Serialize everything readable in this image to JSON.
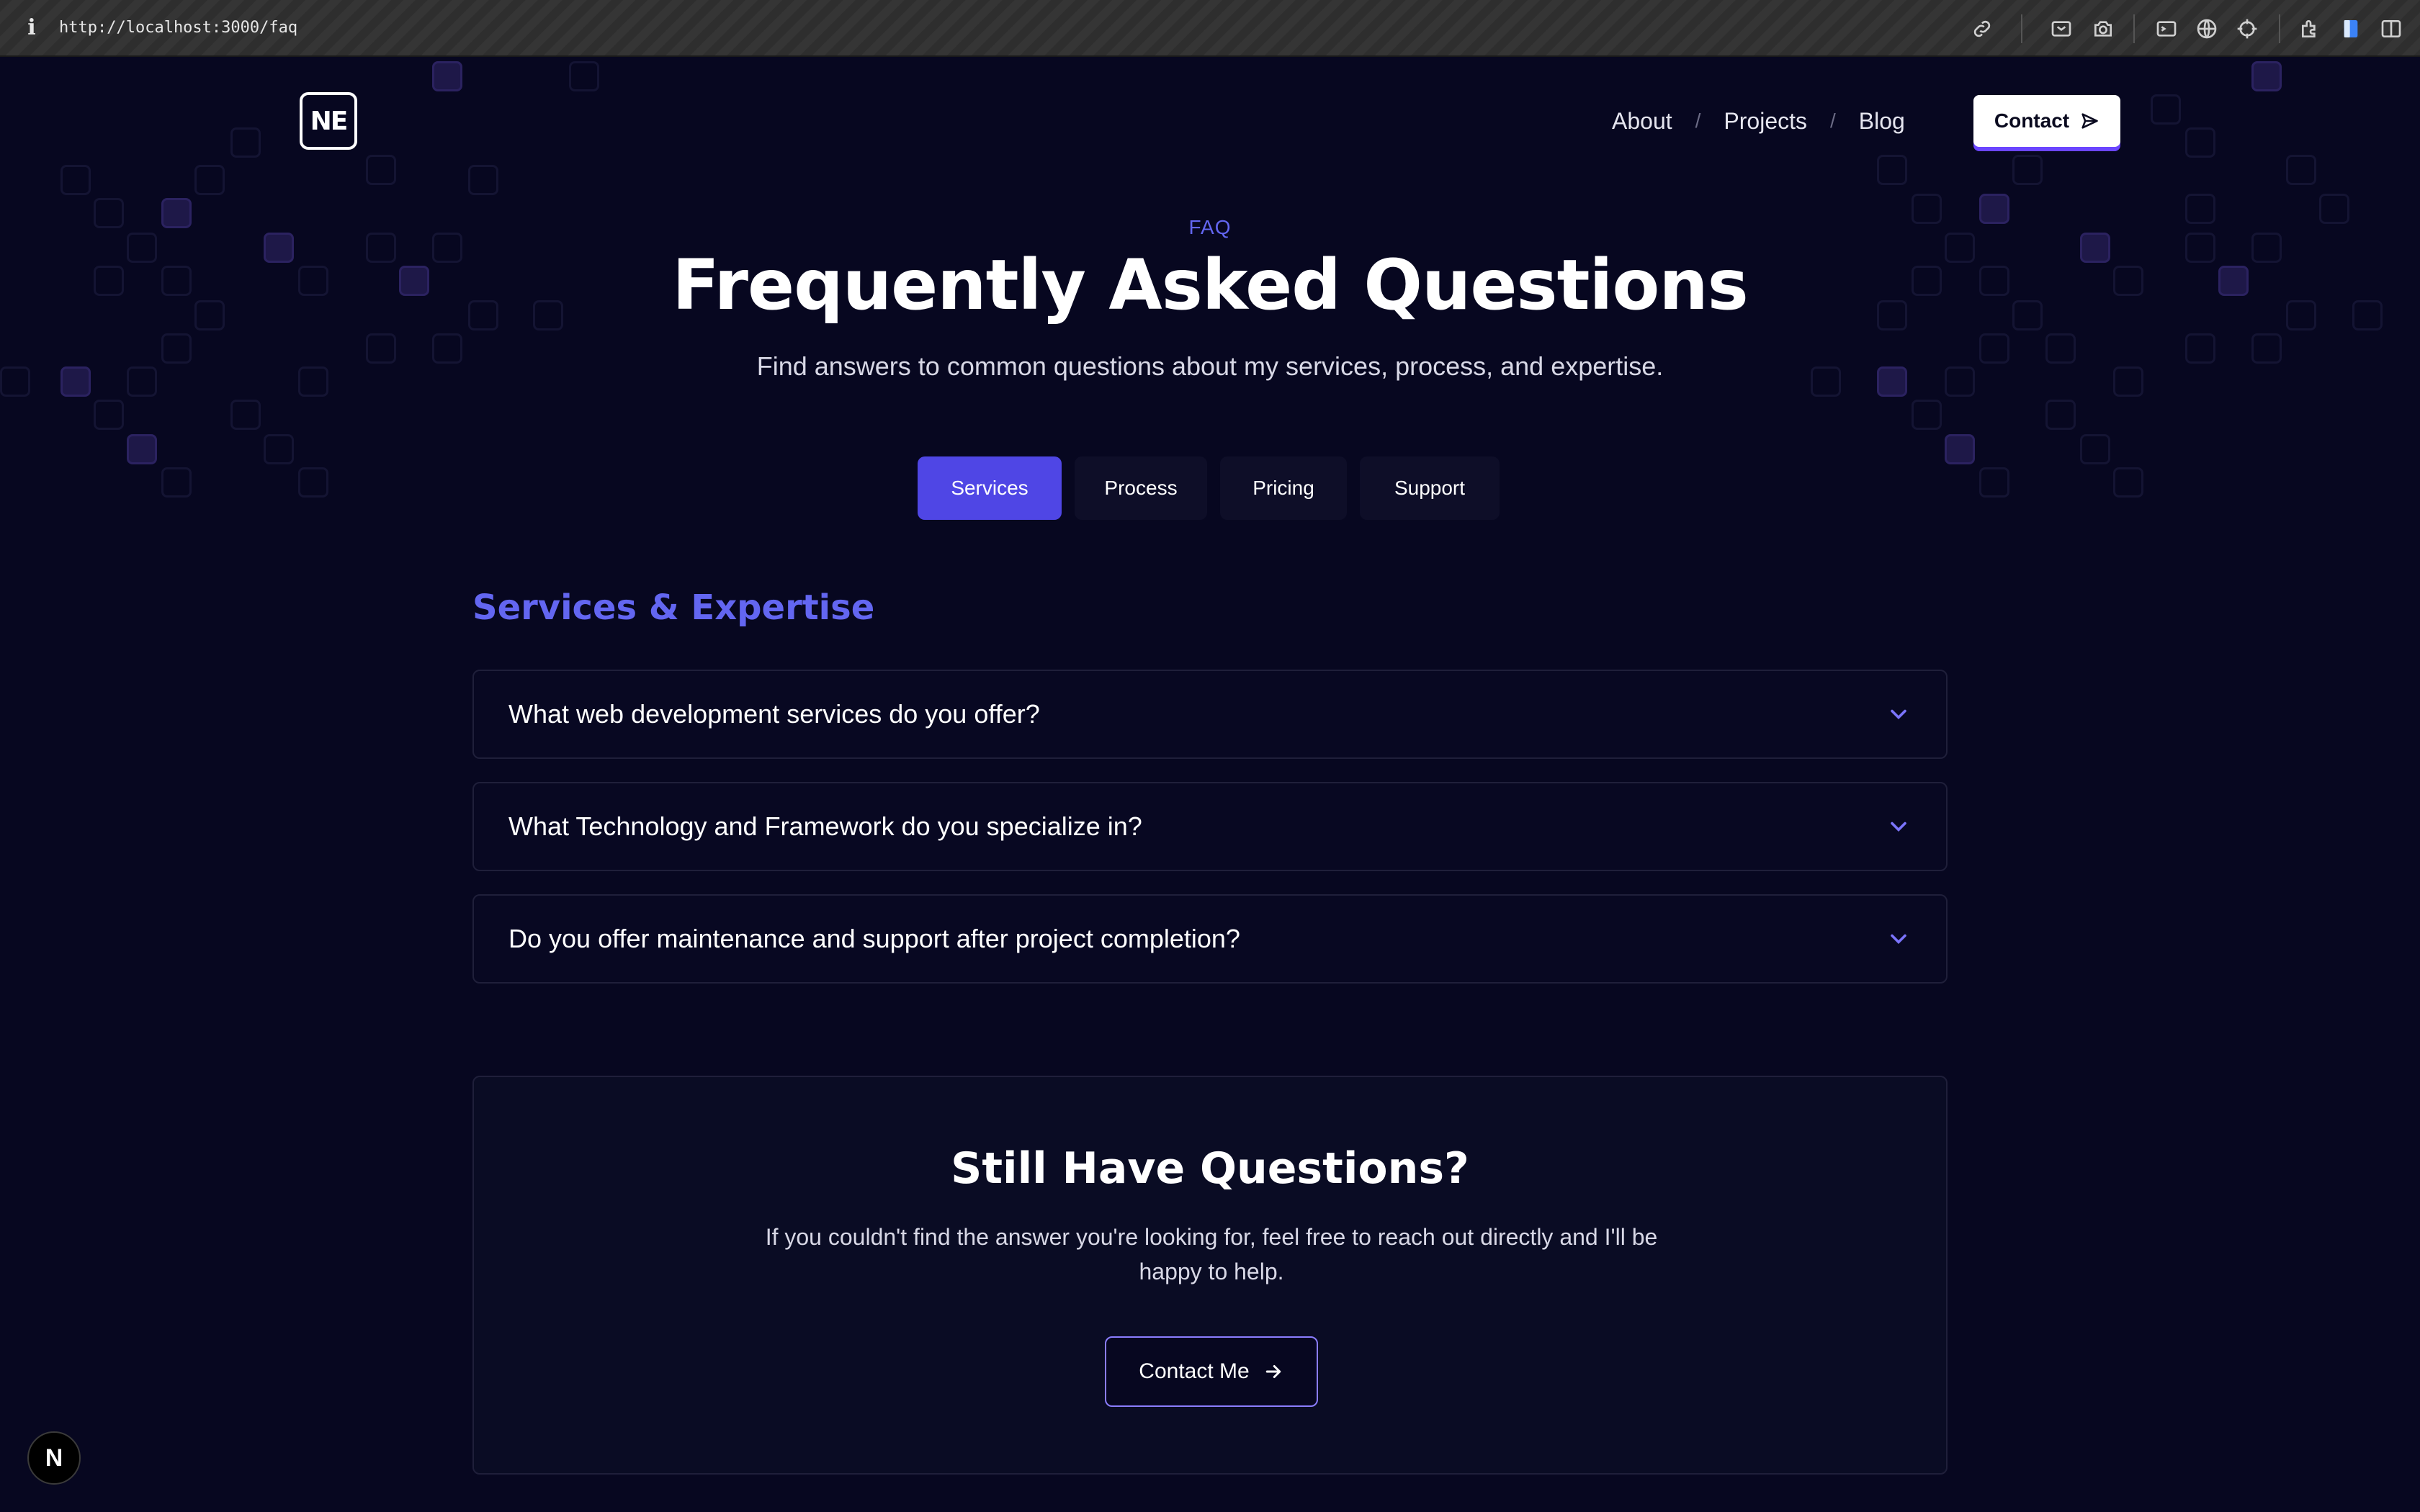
{
  "browser": {
    "url": "http://localhost:3000/faq",
    "icons": [
      "info-icon",
      "link-icon",
      "reader-icon",
      "camera-icon",
      "terminal-icon",
      "globe-icon",
      "crosshair-icon",
      "extension-icon",
      "sidebar-color-icon",
      "split-view-icon"
    ]
  },
  "header": {
    "logo_text": "NE",
    "nav": [
      {
        "label": "About"
      },
      {
        "label": "Projects"
      },
      {
        "label": "Blog"
      }
    ],
    "separator": "/",
    "contact_label": "Contact"
  },
  "hero": {
    "eyebrow": "FAQ",
    "title": "Frequently Asked Questions",
    "subtitle": "Find answers to common questions about my services, process, and expertise."
  },
  "tabs": [
    {
      "label": "Services",
      "active": true
    },
    {
      "label": "Process",
      "active": false
    },
    {
      "label": "Pricing",
      "active": false
    },
    {
      "label": "Support",
      "active": false
    }
  ],
  "section": {
    "title": "Services & Expertise",
    "questions": [
      "What web development services do you offer?",
      "What Technology and Framework do you specialize in?",
      "Do you offer maintenance and support after project completion?"
    ]
  },
  "cta": {
    "title": "Still Have Questions?",
    "text": "If you couldn't find the answer you're looking for, feel free to reach out directly and I'll be happy to help.",
    "button_label": "Contact Me"
  },
  "dev_badge": "N",
  "colors": {
    "background": "#070720",
    "accent": "#6366f1",
    "active_tab": "#4f46e5",
    "cta_border": "#8b7dff"
  }
}
